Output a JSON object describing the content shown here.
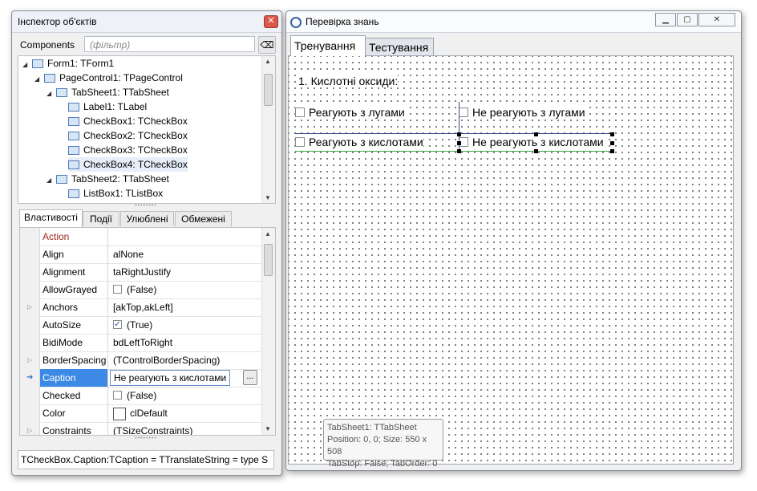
{
  "inspector": {
    "title": "Інспектор об'єктів",
    "components_label": "Components",
    "filter_placeholder": "(фільтр)",
    "tree": [
      {
        "label": "Form1: TForm1"
      },
      {
        "label": "PageControl1: TPageControl"
      },
      {
        "label": "TabSheet1: TTabSheet"
      },
      {
        "label": "Label1: TLabel"
      },
      {
        "label": "CheckBox1: TCheckBox"
      },
      {
        "label": "CheckBox2: TCheckBox"
      },
      {
        "label": "CheckBox3: TCheckBox"
      },
      {
        "label": "CheckBox4: TCheckBox"
      },
      {
        "label": "TabSheet2: TTabSheet"
      },
      {
        "label": "ListBox1: TListBox"
      }
    ],
    "tabs": [
      "Властивості",
      "Події",
      "Улюблені",
      "Обмежені"
    ],
    "properties": [
      {
        "name": "Action",
        "value": ""
      },
      {
        "name": "Align",
        "value": "alNone"
      },
      {
        "name": "Alignment",
        "value": "taRightJustify"
      },
      {
        "name": "AllowGrayed",
        "value": "(False)"
      },
      {
        "name": "Anchors",
        "value": "[akTop,akLeft]"
      },
      {
        "name": "AutoSize",
        "value": "(True)"
      },
      {
        "name": "BidiMode",
        "value": "bdLeftToRight"
      },
      {
        "name": "BorderSpacing",
        "value": "(TControlBorderSpacing)"
      },
      {
        "name": "Caption",
        "value": "Не реагують з кислотами"
      },
      {
        "name": "Checked",
        "value": "(False)"
      },
      {
        "name": "Color",
        "value": "clDefault"
      },
      {
        "name": "Constraints",
        "value": "(TSizeConstraints)"
      }
    ],
    "ellipsis_label": "...",
    "status": "TCheckBox.Caption:TCaption = TTranslateString = type S"
  },
  "form": {
    "title": "Перевірка знань",
    "tabs": [
      "Тренування",
      "Тестування"
    ],
    "label1": "1. Кислотні оксиди:",
    "checkboxes": [
      "Реагують з лугами",
      "Не реагують з лугами",
      "Реагують з кислотами",
      "Не реагують з кислотами"
    ],
    "hint": {
      "line1": "TabSheet1: TTabSheet",
      "line2": "Position: 0, 0; Size: 550 x 508",
      "line3": "TabStop: False; TabOrder: 0"
    }
  },
  "colors": {
    "selection": "#3c8ae6",
    "action_text": "#a0281e",
    "close_button": "#d9574c"
  }
}
